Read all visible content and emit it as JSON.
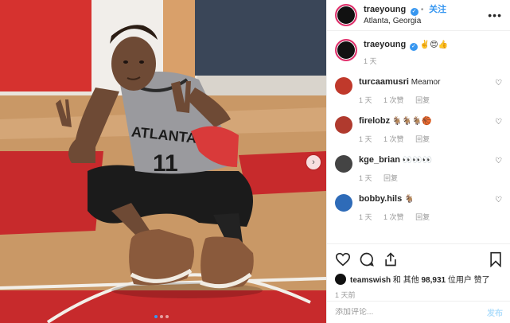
{
  "post": {
    "username": "traeyoung",
    "follow_label": "关注",
    "location": "Atlanta, Georgia",
    "more_glyph": "•••",
    "verified_glyph": "✓"
  },
  "photo": {
    "jersey_text": "ATLANTA",
    "jersey_number": "11",
    "colors": {
      "wall": "#d6322f",
      "floor": "#c99866",
      "court_red": "#c72a2c",
      "jersey": "#9a9a9e",
      "shorts": "#1b1b1b"
    }
  },
  "caption": {
    "username": "traeyoung",
    "text": "✌️😊👍",
    "time": "1 天"
  },
  "comments": [
    {
      "username": "turcaamusri",
      "text": "Meamor",
      "time": "1 天",
      "likes": "1 次赞",
      "reply": "回复",
      "avatar_color": "#c0392b"
    },
    {
      "username": "firelobz",
      "text": "🐐🐐🐐🏀",
      "time": "1 天",
      "likes": "1 次赞",
      "reply": "回复",
      "avatar_color": "#b03a2e"
    },
    {
      "username": "kge_brian",
      "text": "👀👀👀",
      "time": "1 天",
      "likes": "",
      "reply": "回复",
      "avatar_color": "#444444"
    },
    {
      "username": "bobby.hils",
      "text": "🐐",
      "time": "1 天",
      "likes": "1 次赞",
      "reply": "回复",
      "avatar_color": "#2e6bb8"
    }
  ],
  "likes": {
    "liker": "teamswish",
    "text_mid": " 和 其他 ",
    "count": "98,931",
    "text_end": " 位用户 赞了"
  },
  "post_time": "1 天前",
  "add_comment": {
    "placeholder": "添加评论...",
    "post_label": "发布"
  },
  "icons": [
    "heart-icon",
    "comment-icon",
    "share-icon",
    "bookmark-icon",
    "chevron-right-icon"
  ],
  "accent": "#3897f0"
}
